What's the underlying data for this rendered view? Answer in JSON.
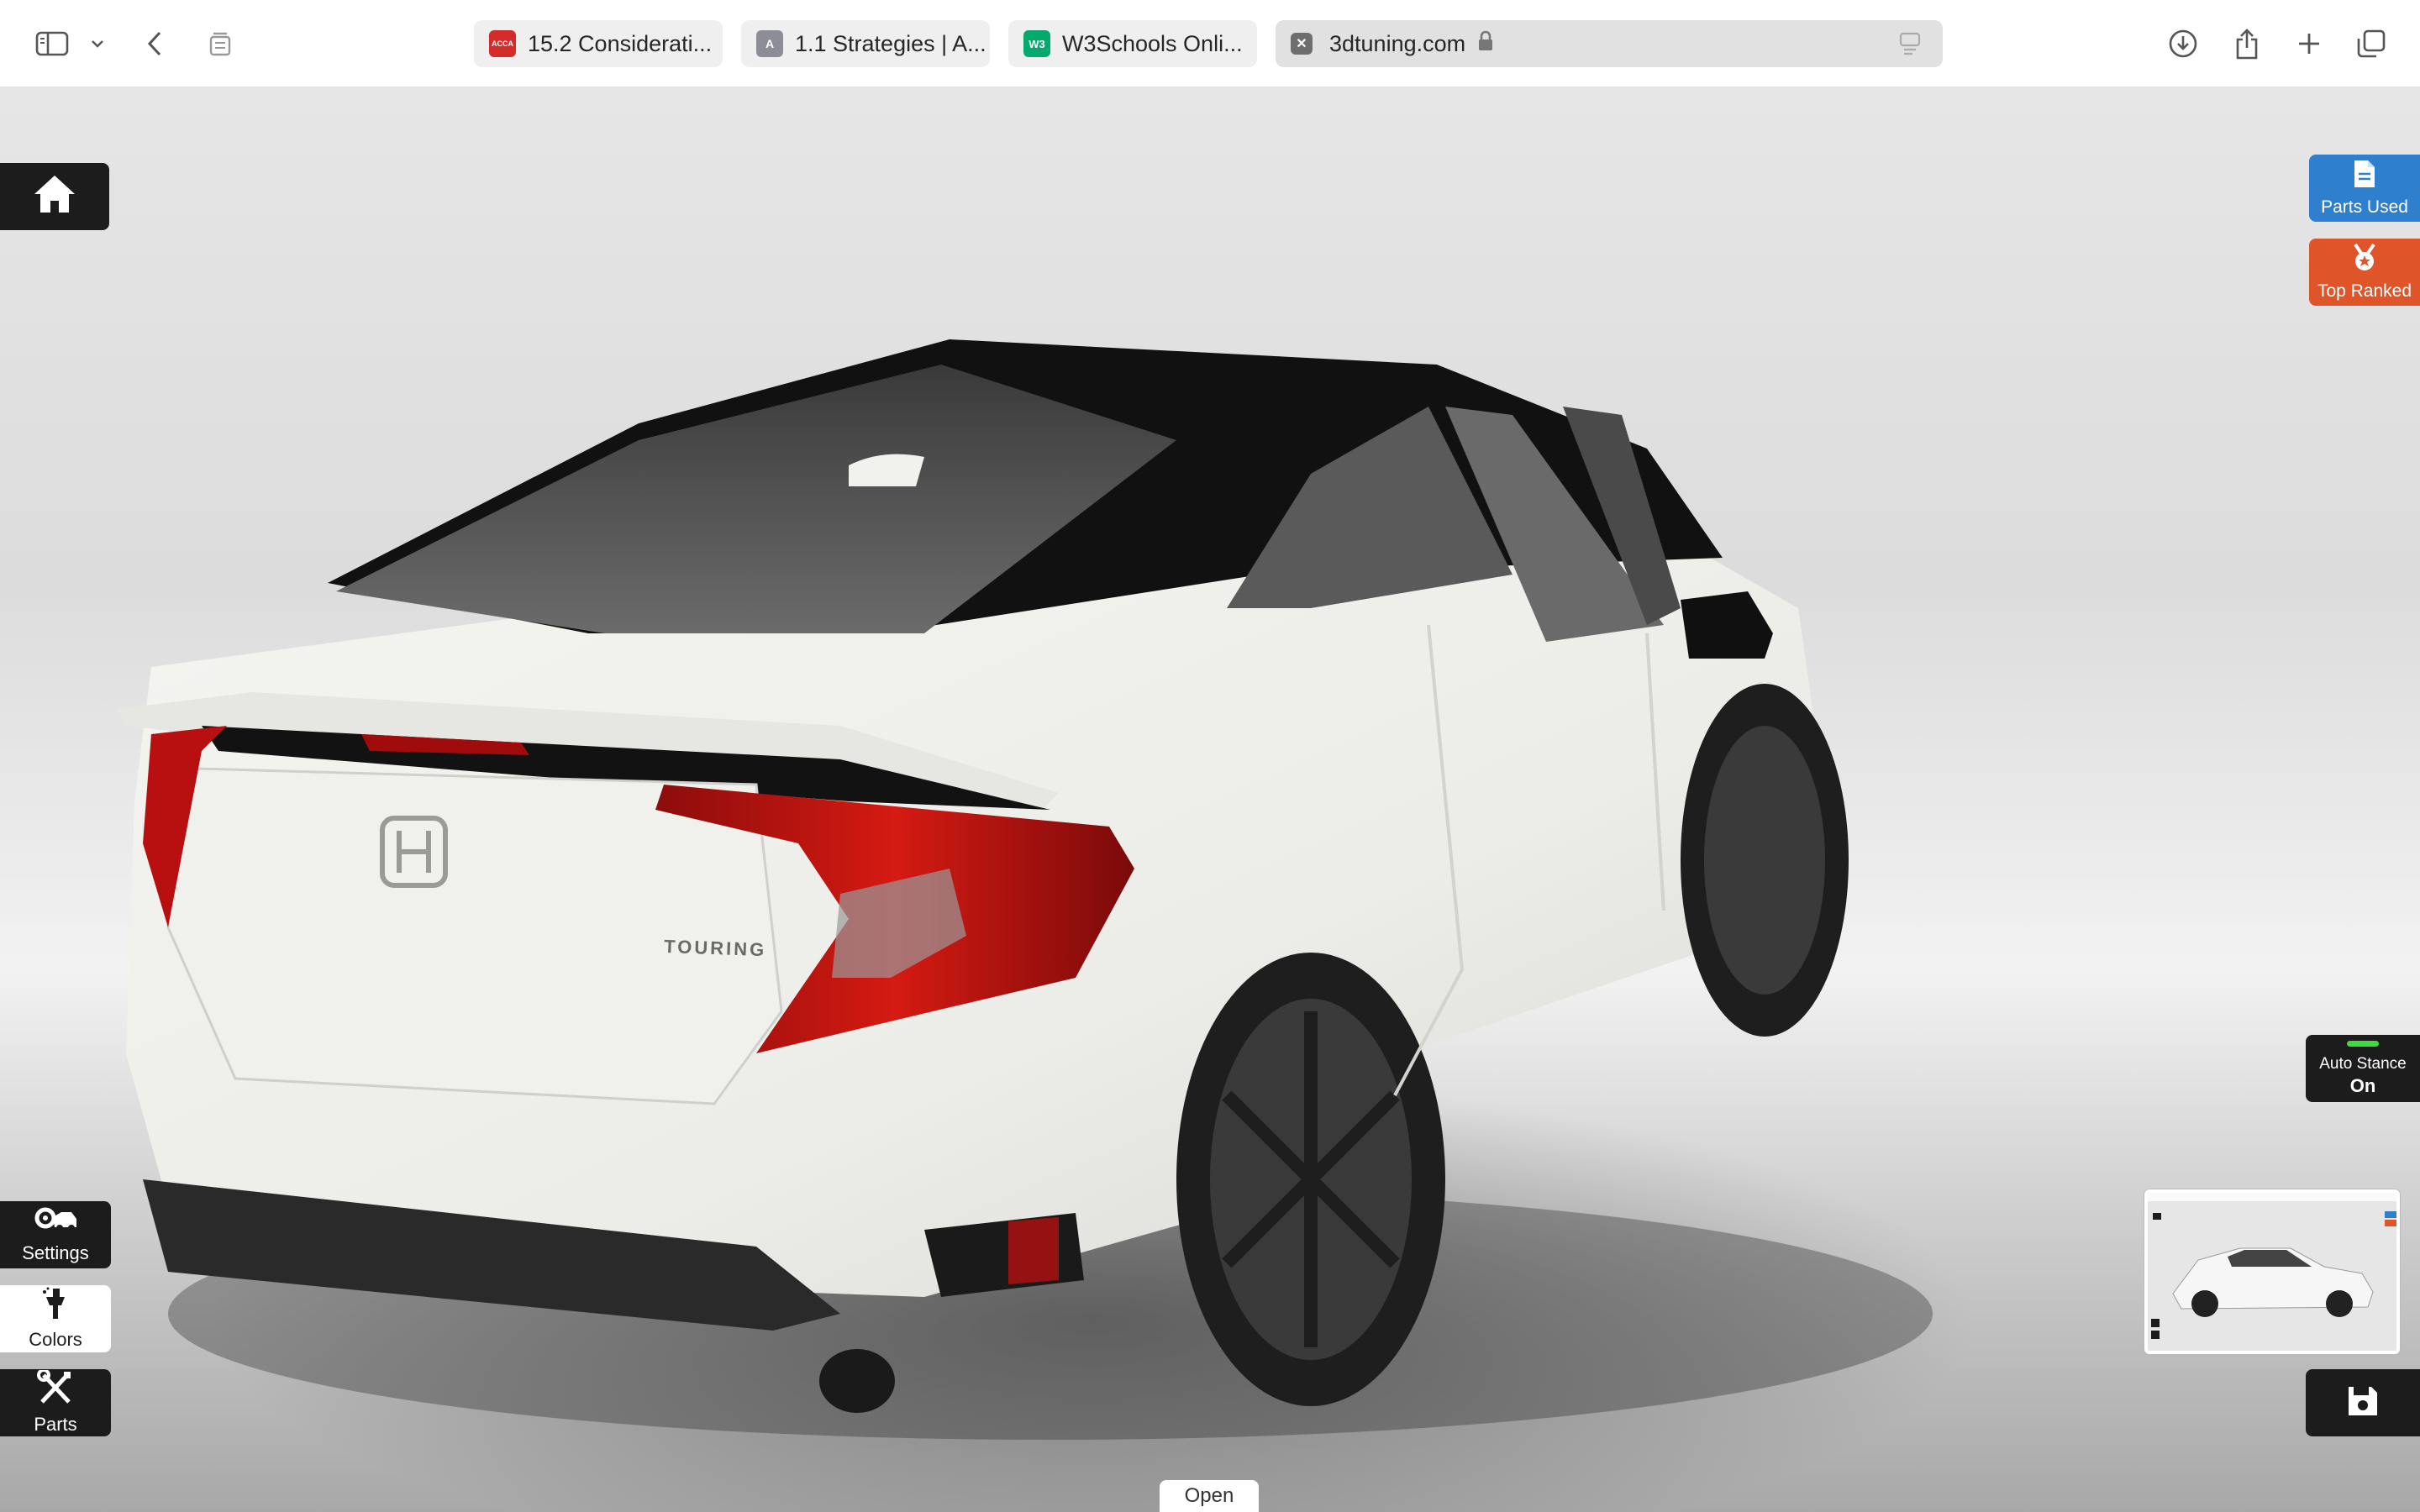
{
  "browser": {
    "tabs": [
      {
        "label": "15.2 Considerati...",
        "favicon_text": "ACCA",
        "favicon_color": "#d42b2b"
      },
      {
        "label": "1.1 Strategies | A...",
        "favicon_text": "A",
        "favicon_color": "#8d8d98"
      },
      {
        "label": "W3Schools Onli...",
        "favicon_text": "W3",
        "favicon_color": "#04aa6d"
      }
    ],
    "active_tab": {
      "label": "3dtuning.com",
      "favicon_text": "✕"
    },
    "icons": [
      "sidebar-icon",
      "chevron-down-icon",
      "back-icon",
      "tab-overview-icon",
      "download-icon",
      "share-icon",
      "new-tab-icon",
      "tabs-grid-icon"
    ]
  },
  "viewer": {
    "home_icon": "home-icon",
    "left_menu": {
      "settings": "Settings",
      "colors": "Colors",
      "parts": "Parts"
    },
    "right_menu": {
      "parts_used": "Parts Used",
      "top_ranked": "Top Ranked"
    },
    "auto_stance": {
      "label": "Auto Stance",
      "state": "On"
    },
    "open_label": "Open",
    "car_badge": "TOURING",
    "colors": {
      "parts_used_bg": "#2f7fcf",
      "top_ranked_bg": "#e0542a",
      "stance_led": "#3bdc3b",
      "panel_bg": "#1c1c1c"
    }
  }
}
